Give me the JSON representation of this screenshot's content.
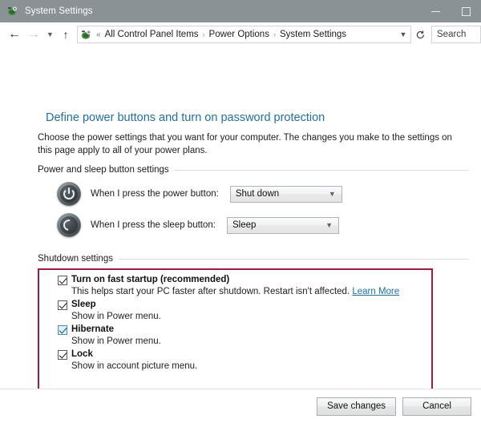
{
  "window": {
    "title": "System Settings",
    "icon": "control-panel-icon",
    "controls": {
      "minimize": "minimize-icon",
      "maximize": "maximize-icon"
    }
  },
  "navbar": {
    "back": "back-arrow-icon",
    "forward": "forward-arrow-icon",
    "history": "chevron-down-icon",
    "up": "up-arrow-icon",
    "address_icon": "control-panel-icon",
    "breadcrumb_lead": "«",
    "breadcrumbs": [
      "All Control Panel Items",
      "Power Options",
      "System Settings"
    ],
    "separator": "›",
    "address_chevron": "chevron-down-icon",
    "refresh": "refresh-icon",
    "search_placeholder": "Search"
  },
  "page": {
    "title": "Define power buttons and turn on password protection",
    "description": "Choose the power settings that you want for your computer. The changes you make to the settings on this page apply to all of your power plans."
  },
  "power_sleep_section": {
    "heading": "Power and sleep button settings",
    "rows": [
      {
        "icon": "power-button-icon",
        "label": "When I press the power button:",
        "value": "Shut down"
      },
      {
        "icon": "sleep-button-icon",
        "label": "When I press the sleep button:",
        "value": "Sleep"
      }
    ]
  },
  "shutdown_section": {
    "heading": "Shutdown settings",
    "highlight_color": "#9e1b42",
    "items": [
      {
        "label": "Turn on fast startup (recommended)",
        "checked": true,
        "description": "This helps start your PC faster after shutdown. Restart isn't affected.",
        "link": "Learn More"
      },
      {
        "label": "Sleep",
        "checked": true,
        "description": "Show in Power menu.",
        "link": ""
      },
      {
        "label": "Hibernate",
        "checked": true,
        "description": "Show in Power menu.",
        "link": ""
      },
      {
        "label": "Lock",
        "checked": true,
        "description": "Show in account picture menu.",
        "link": ""
      }
    ]
  },
  "footer": {
    "save_label": "Save changes",
    "cancel_label": "Cancel"
  },
  "colors": {
    "titlebar": "#8a9296",
    "heading_blue": "#1f6fa8",
    "highlight_red": "#9e1b42"
  }
}
